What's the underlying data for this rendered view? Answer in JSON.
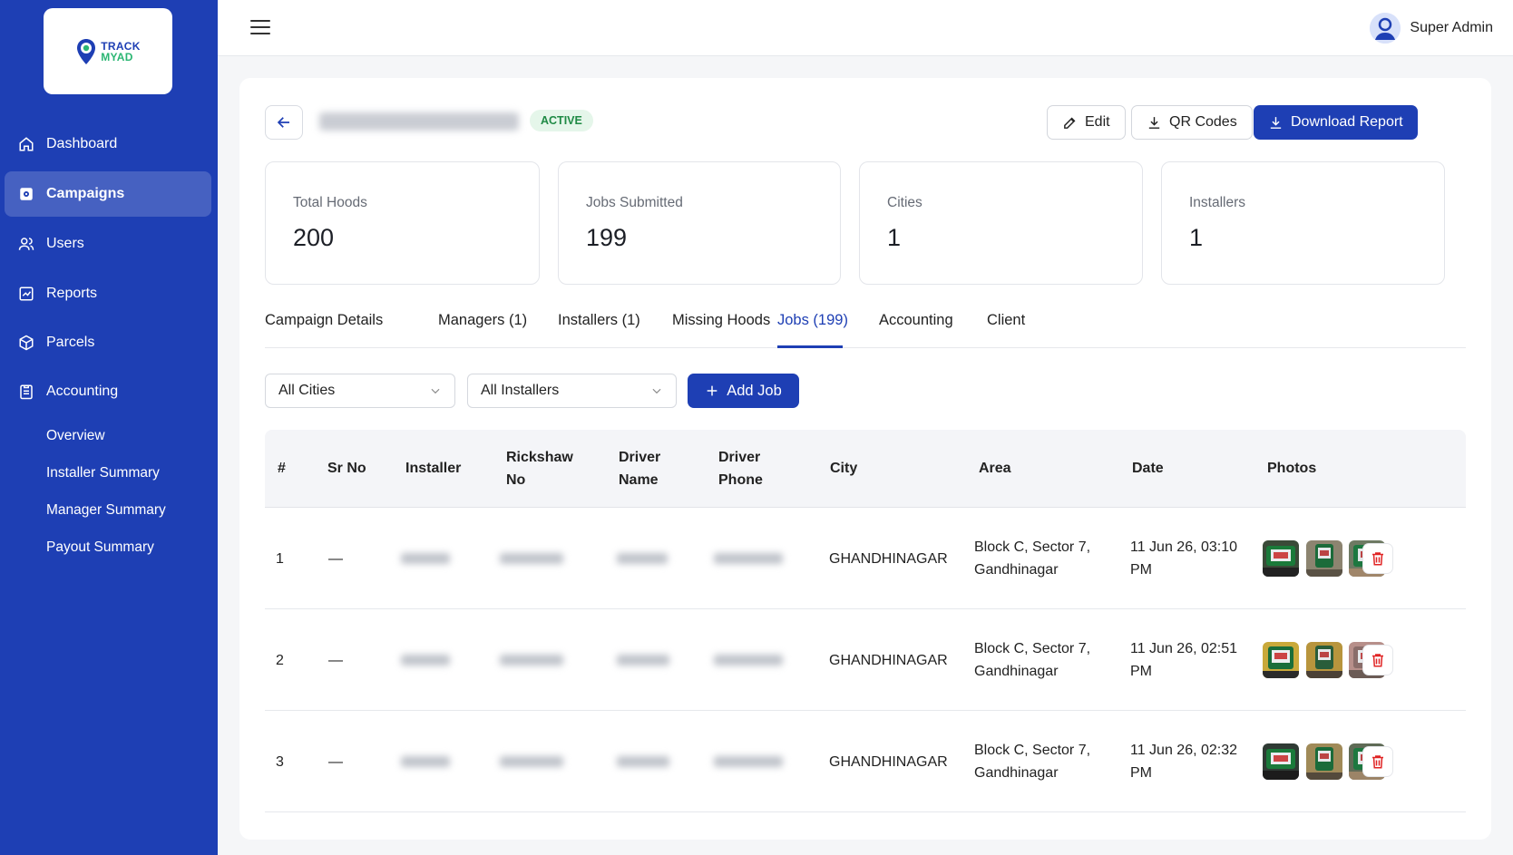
{
  "brand": {
    "line1": "TRACK",
    "line2": "MYAD",
    "primary_color": "#1e3fb4",
    "accent_color": "#2bb673"
  },
  "sidebar": {
    "items": [
      {
        "label": "Dashboard",
        "icon": "home-icon"
      },
      {
        "label": "Campaigns",
        "icon": "campaign-icon",
        "active": true
      },
      {
        "label": "Users",
        "icon": "users-icon"
      },
      {
        "label": "Reports",
        "icon": "chart-icon"
      },
      {
        "label": "Parcels",
        "icon": "box-icon"
      },
      {
        "label": "Accounting",
        "icon": "clipboard-icon"
      }
    ],
    "subitems": [
      {
        "label": "Overview"
      },
      {
        "label": "Installer Summary"
      },
      {
        "label": "Manager Summary"
      },
      {
        "label": "Payout Summary"
      }
    ]
  },
  "topbar": {
    "user_name": "Super Admin"
  },
  "campaign": {
    "status": "ACTIVE"
  },
  "actions": {
    "edit": "Edit",
    "qr": "QR Codes",
    "download": "Download Report"
  },
  "stats": [
    {
      "label": "Total Hoods",
      "value": "200"
    },
    {
      "label": "Jobs Submitted",
      "value": "199"
    },
    {
      "label": "Cities",
      "value": "1"
    },
    {
      "label": "Installers",
      "value": "1"
    }
  ],
  "tabs": [
    {
      "label": "Campaign Details"
    },
    {
      "label": "Managers (1)"
    },
    {
      "label": "Installers (1)"
    },
    {
      "label": "Missing Hoods"
    },
    {
      "label": "Jobs (199)",
      "active": true
    },
    {
      "label": "Accounting"
    },
    {
      "label": "Client"
    }
  ],
  "filters": {
    "city": "All Cities",
    "installer": "All Installers",
    "add_job": "Add Job"
  },
  "table": {
    "headers": {
      "num": "#",
      "sr": "Sr No",
      "installer": "Installer",
      "rickshaw_1": "Rickshaw",
      "rickshaw_2": "No",
      "driver_name_1": "Driver",
      "driver_name_2": "Name",
      "driver_phone_1": "Driver",
      "driver_phone_2": "Phone",
      "city": "City",
      "area": "Area",
      "date": "Date",
      "photos": "Photos"
    },
    "rows": [
      {
        "num": "1",
        "sr": "—",
        "city": "GHANDHINAGAR",
        "area_1": "Block C, Sector 7,",
        "area_2": "Gandhinagar",
        "date_1": "11 Jun 26, 03:10",
        "date_2": "PM"
      },
      {
        "num": "2",
        "sr": "—",
        "city": "GHANDHINAGAR",
        "area_1": "Block C, Sector 7,",
        "area_2": "Gandhinagar",
        "date_1": "11 Jun 26, 02:51",
        "date_2": "PM"
      },
      {
        "num": "3",
        "sr": "—",
        "city": "GHANDHINAGAR",
        "area_1": "Block C, Sector 7,",
        "area_2": "Gandhinagar",
        "date_1": "11 Jun 26, 02:32",
        "date_2": "PM"
      }
    ]
  }
}
